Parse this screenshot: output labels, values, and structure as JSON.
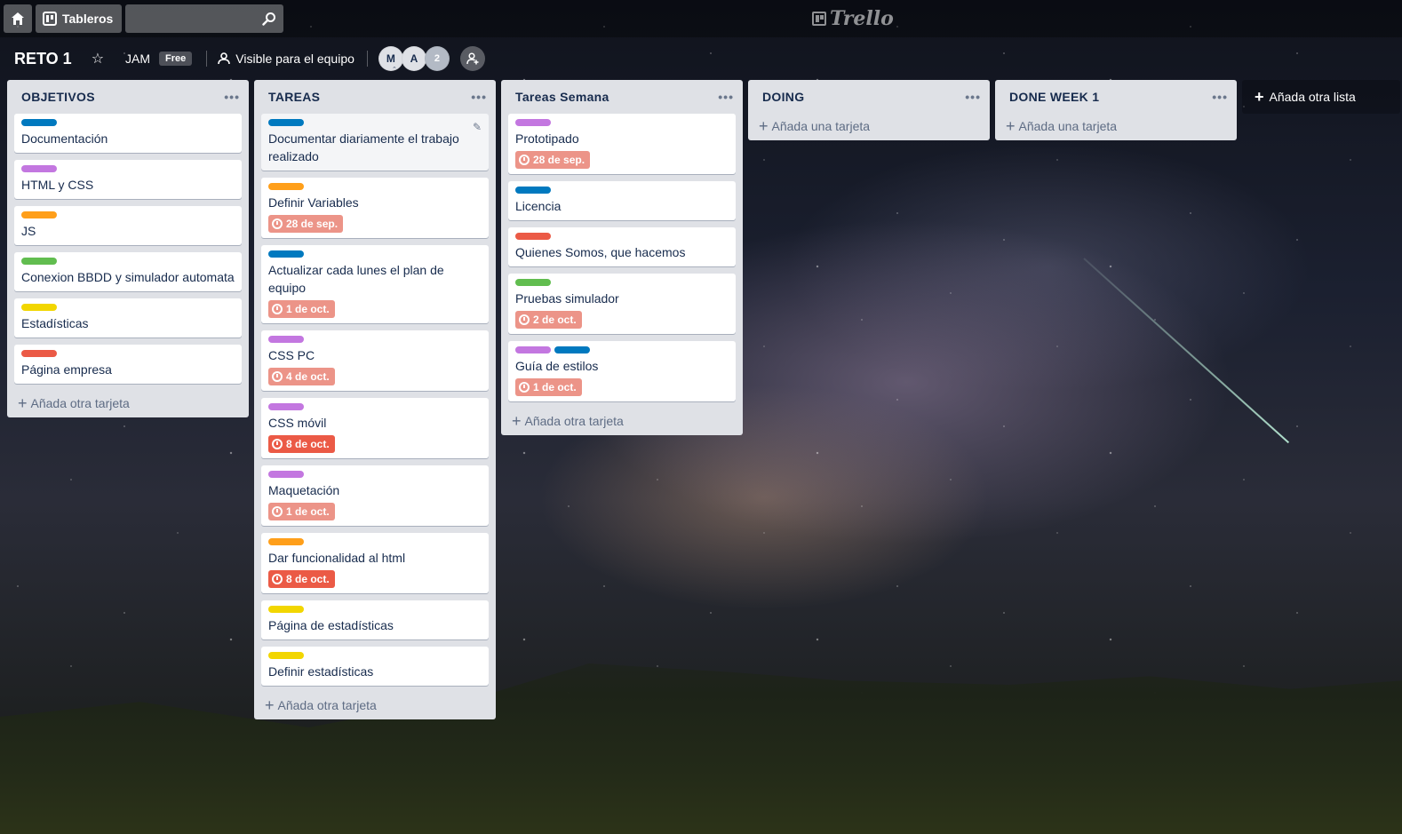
{
  "colors": {
    "blue": "#0079bf",
    "purple": "#c377e0",
    "orange": "#ff9f1a",
    "green": "#61bd4f",
    "yellow": "#f2d600",
    "red": "#eb5a46",
    "due_soon": "#ec9488",
    "due_overdue": "#eb5a46"
  },
  "topbar": {
    "boards_label": "Tableros",
    "search_placeholder": "",
    "logo_text": "Trello"
  },
  "board": {
    "title": "RETO 1",
    "team": "JAM",
    "team_badge": "Free",
    "visibility": "Visible para el equipo",
    "members": [
      "M",
      "A"
    ],
    "member_count": "2"
  },
  "lists": [
    {
      "title": "OBJETIVOS",
      "add_label": "Añada otra tarjeta",
      "cards": [
        {
          "labels": [
            "blue"
          ],
          "title": "Documentación"
        },
        {
          "labels": [
            "purple"
          ],
          "title": "HTML y CSS"
        },
        {
          "labels": [
            "orange"
          ],
          "title": "JS"
        },
        {
          "labels": [
            "green"
          ],
          "title": "Conexion BBDD y simulador automata"
        },
        {
          "labels": [
            "yellow"
          ],
          "title": "Estadísticas"
        },
        {
          "labels": [
            "red"
          ],
          "title": "Página empresa"
        }
      ]
    },
    {
      "title": "TAREAS",
      "add_label": "Añada otra tarjeta",
      "cards": [
        {
          "labels": [
            "blue"
          ],
          "title": "Documentar diariamente el trabajo realizado",
          "editing": true
        },
        {
          "labels": [
            "orange"
          ],
          "title": "Definir Variables",
          "due": "28 de sep.",
          "due_state": "soon"
        },
        {
          "labels": [
            "blue"
          ],
          "title": "Actualizar cada lunes el plan de equipo",
          "due": "1 de oct.",
          "due_state": "soon"
        },
        {
          "labels": [
            "purple"
          ],
          "title": "CSS PC",
          "due": "4 de oct.",
          "due_state": "soon"
        },
        {
          "labels": [
            "purple"
          ],
          "title": "CSS móvil",
          "due": "8 de oct.",
          "due_state": "overdue"
        },
        {
          "labels": [
            "purple"
          ],
          "title": "Maquetación",
          "due": "1 de oct.",
          "due_state": "soon"
        },
        {
          "labels": [
            "orange"
          ],
          "title": "Dar funcionalidad al html",
          "due": "8 de oct.",
          "due_state": "overdue"
        },
        {
          "labels": [
            "yellow"
          ],
          "title": "Página de estadísticas"
        },
        {
          "labels": [
            "yellow"
          ],
          "title": "Definir estadísticas"
        }
      ]
    },
    {
      "title": "Tareas Semana",
      "add_label": "Añada otra tarjeta",
      "cards": [
        {
          "labels": [
            "purple"
          ],
          "title": "Prototipado",
          "due": "28 de sep.",
          "due_state": "soon"
        },
        {
          "labels": [
            "blue"
          ],
          "title": "Licencia"
        },
        {
          "labels": [
            "red"
          ],
          "title": "Quienes Somos, que hacemos"
        },
        {
          "labels": [
            "green"
          ],
          "title": "Pruebas simulador",
          "due": "2 de oct.",
          "due_state": "soon"
        },
        {
          "labels": [
            "purple",
            "blue"
          ],
          "title": "Guía de estilos",
          "due": "1 de oct.",
          "due_state": "soon"
        }
      ]
    },
    {
      "title": "DOING",
      "add_label": "Añada una tarjeta",
      "cards": []
    },
    {
      "title": "DONE WEEK 1",
      "add_label": "Añada una tarjeta",
      "cards": []
    }
  ],
  "add_list_label": "Añada otra lista"
}
